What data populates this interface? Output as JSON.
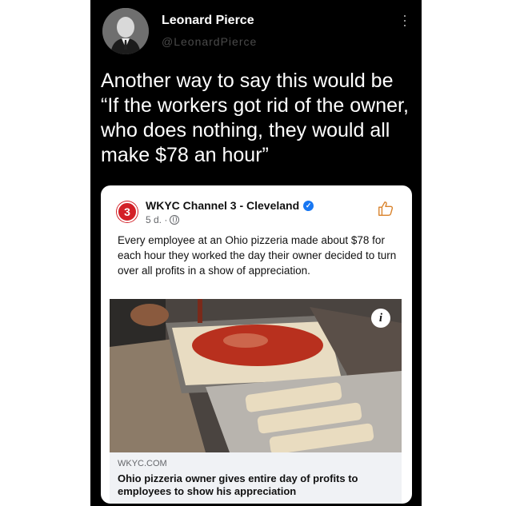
{
  "post": {
    "author": "Leonard Pierce",
    "handle": "@LeonardPierce",
    "text": "Another way to say this would be “If the workers got rid of the owner, who does nothing, they would all make $78 an hour”",
    "menu_icon": "vertical-ellipsis-icon"
  },
  "card": {
    "page_avatar_label": "3",
    "page_name": "WKYC Channel 3 - Cleveland",
    "meta": "5 d. ·",
    "caption": "Every employee at an Ohio pizzeria made about $78 for each hour they worked the day their owner decided to turn over all profits in a show of appreciation.",
    "info_label": "i",
    "link": {
      "domain": "WKYC.COM",
      "title": "Ohio pizzeria owner gives entire day of profits to employees to show his appreciation"
    }
  },
  "colors": {
    "background": "#000000",
    "card": "#ffffff",
    "verified": "#1877f2",
    "station": "#d32027"
  }
}
